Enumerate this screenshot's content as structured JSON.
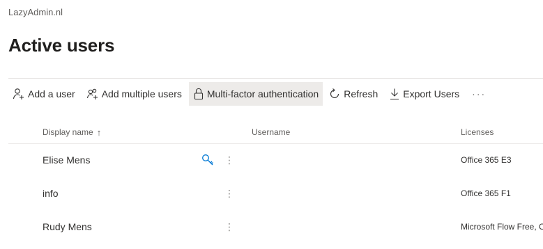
{
  "org_name": "LazyAdmin.nl",
  "page_title": "Active users",
  "toolbar": {
    "add_user": "Add a user",
    "add_multiple": "Add multiple users",
    "mfa": "Multi-factor authentication",
    "refresh": "Refresh",
    "export": "Export Users",
    "more": "···"
  },
  "columns": {
    "display_name": "Display name",
    "sort_arrow": "↑",
    "username": "Username",
    "licenses": "Licenses"
  },
  "users": [
    {
      "name": "Elise Mens",
      "username": "",
      "license": "Office 365 E3",
      "more": "⋮"
    },
    {
      "name": "info",
      "username": "",
      "license": "Office 365 F1",
      "more": "⋮"
    },
    {
      "name": "Rudy Mens",
      "username": "",
      "license": "Microsoft Flow Free, Off",
      "more": "⋮"
    }
  ],
  "icons": {
    "add_user": "person-add-icon",
    "add_multiple": "people-add-icon",
    "mfa": "lock-icon",
    "refresh": "refresh-icon",
    "export": "download-icon",
    "key": "key-icon"
  },
  "colors": {
    "accent": "#0078d4",
    "active_button_bg": "#edebe9"
  }
}
